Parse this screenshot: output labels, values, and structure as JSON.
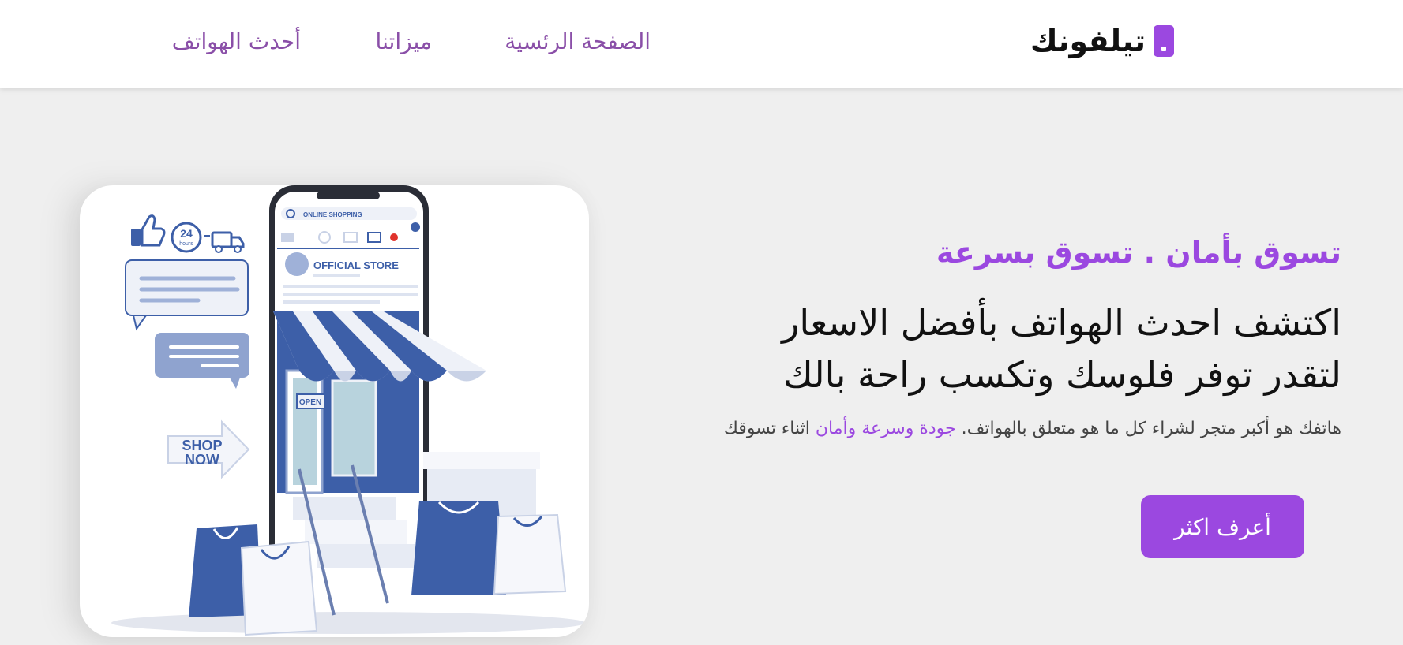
{
  "brand": {
    "name": "تيلفونك",
    "icon": "phone-icon",
    "accent_color": "#9b48e0"
  },
  "nav": {
    "items": [
      {
        "label": "الصفحة الرئسية"
      },
      {
        "label": "ميزاتنا"
      },
      {
        "label": "أحدث الهواتف"
      }
    ]
  },
  "hero": {
    "tagline": "تسوق بأمان . تسوق بسرعة",
    "headline_line1": "اكتشف احدث الهواتف بأفضل الاسعار",
    "headline_line2": "لتقدر توفر فلوسك وتكسب راحة بالك",
    "description_before": "هاتفك هو أكبر متجر لشراء كل ما هو متعلق بالهواتف.",
    "description_highlight": "جودة وسرعة وأمان",
    "description_after": "اثناء تسوقك",
    "cta_label": "أعرف اكثر",
    "illustration": {
      "search_text": "ONLINE SHOPPING",
      "store_title": "OFFICIAL STORE",
      "open_sign": "OPEN",
      "badge_24": "24",
      "badge_hours": "hours",
      "shop_now_1": "SHOP",
      "shop_now_2": "NOW"
    }
  }
}
